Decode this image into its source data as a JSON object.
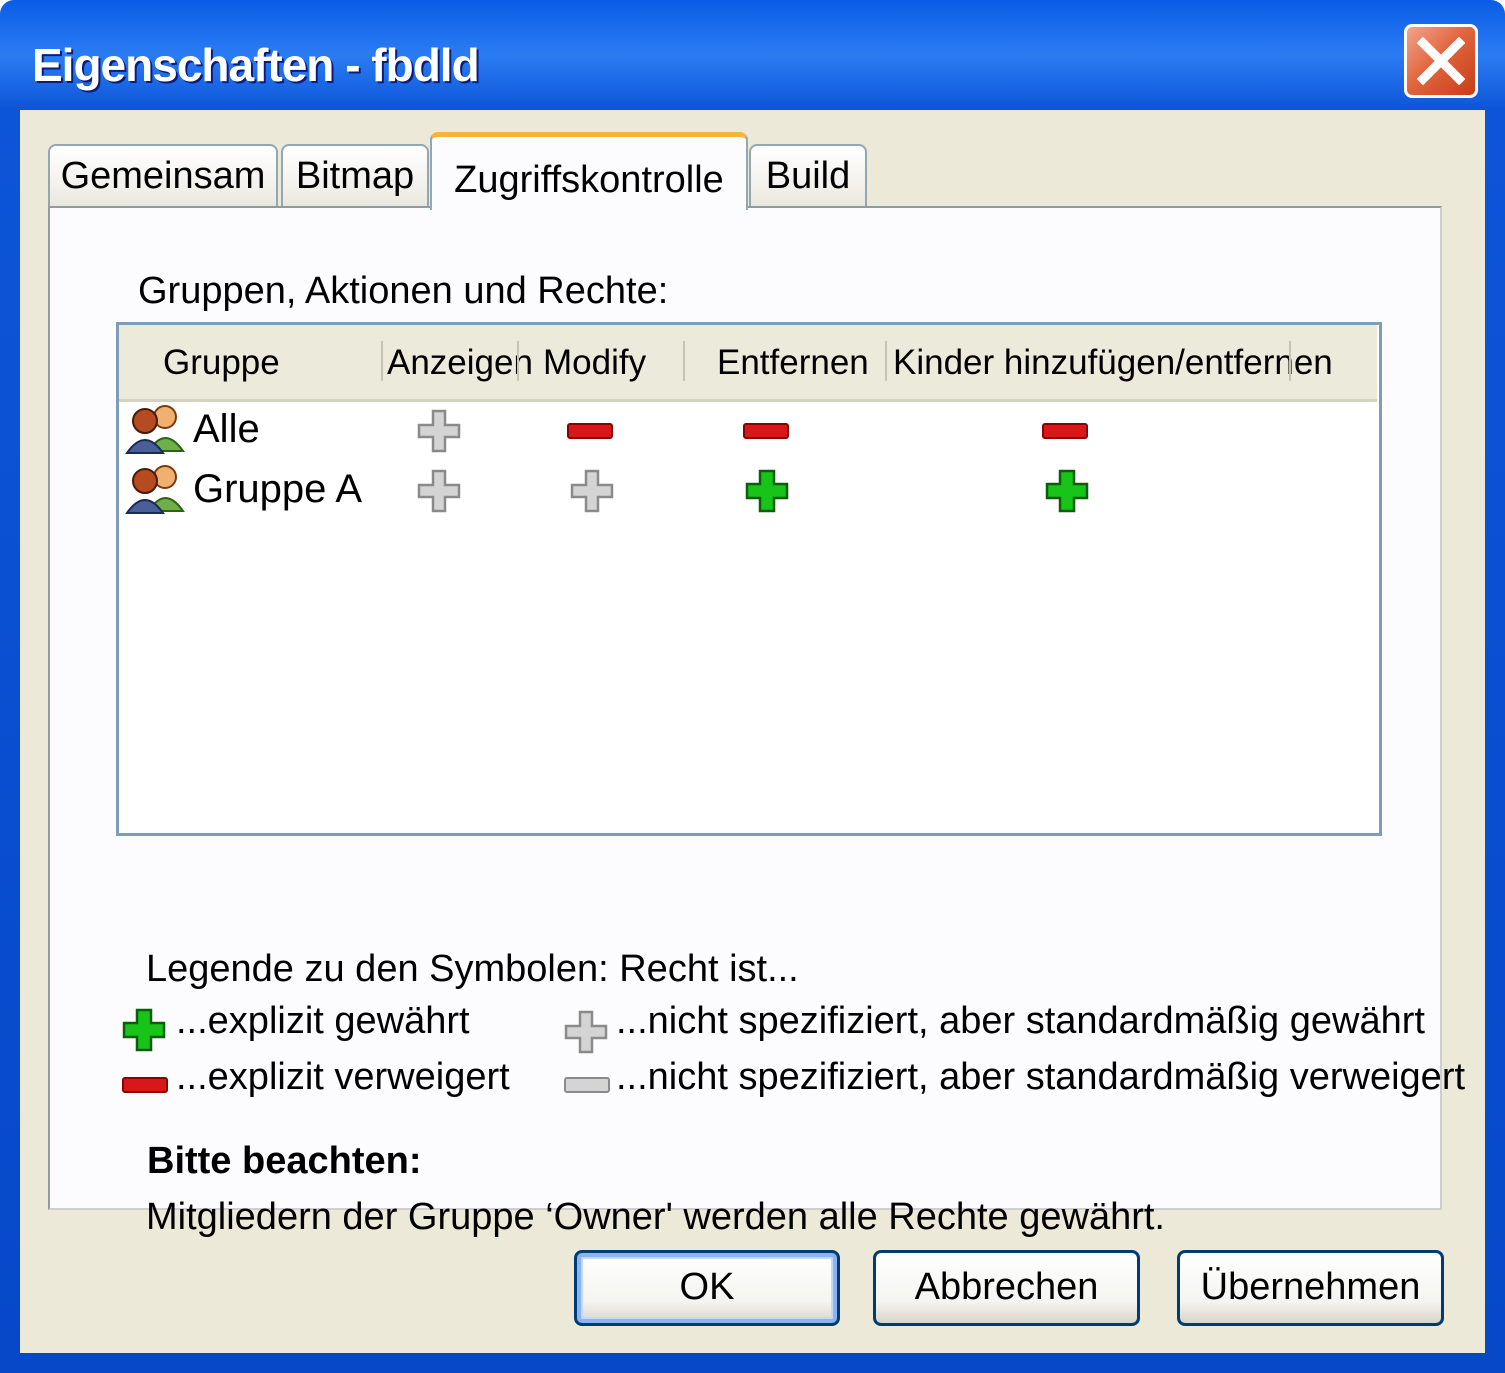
{
  "window": {
    "title": "Eigenschaften - fbdld"
  },
  "tabs": [
    {
      "label": "Gemeinsam",
      "active": false
    },
    {
      "label": "Bitmap",
      "active": false
    },
    {
      "label": "Zugriffskontrolle",
      "active": true
    },
    {
      "label": "Build",
      "active": false
    }
  ],
  "panel": {
    "label": "Gruppen, Aktionen und Rechte:",
    "columns": [
      "Gruppe",
      "Anzeigen",
      "Modify",
      "Entfernen",
      "Kinder hinzufügen/entfernen"
    ],
    "rows": [
      {
        "name": "Alle",
        "icon": "group-icon",
        "rights": [
          "default-granted",
          "explicit-denied",
          "explicit-denied",
          "explicit-denied"
        ]
      },
      {
        "name": "Gruppe A",
        "icon": "group-icon",
        "rights": [
          "default-granted",
          "default-granted",
          "explicit-granted",
          "explicit-granted"
        ]
      }
    ]
  },
  "legend": {
    "title": "Legende zu den Symbolen: Recht ist...",
    "explicit_granted": "...explizit gewährt",
    "explicit_denied": "...explizit verweigert",
    "default_granted": "...nicht spezifiziert, aber standardmäßig gewährt",
    "default_denied": "...nicht spezifiziert, aber standardmäßig verweigert"
  },
  "note": {
    "title": "Bitte beachten:",
    "text": "Mitgliedern der Gruppe ‘Owner' werden alle Rechte gewährt."
  },
  "buttons": {
    "ok": "OK",
    "cancel": "Abbrechen",
    "apply": "Übernehmen"
  },
  "colors": {
    "granted": "#17c417",
    "denied": "#d81818",
    "unspecified": "#bfbfbf",
    "active_tab_accent": "#f7b33a"
  }
}
